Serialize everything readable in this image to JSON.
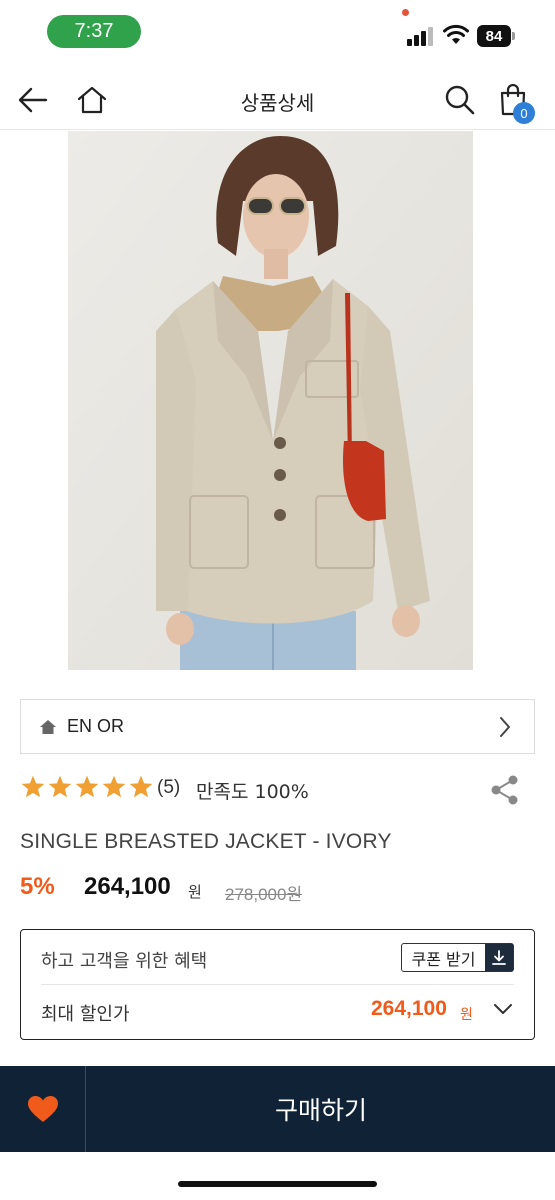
{
  "status_bar": {
    "time": "7:37",
    "battery": "84"
  },
  "header": {
    "title": "상품상세",
    "cart_count": "0",
    "icons": [
      "back-arrow-icon",
      "home-icon",
      "search-icon",
      "shopping-bag-icon"
    ]
  },
  "product": {
    "image_icon": "product-photo",
    "brand": "EN OR",
    "rating": {
      "stars": 5,
      "review_count": "(5)",
      "satisfaction": "만족도 100%"
    },
    "name": "SINGLE BREASTED JACKET - IVORY",
    "price": {
      "discount_rate": "5%",
      "sale_price": "264,100",
      "sale_unit": "원",
      "original_price": "278,000원"
    }
  },
  "benefit": {
    "label": "하고 고객을 위한 혜택",
    "coupon_button": "쿠폰 받기",
    "max_discount_label": "최대 할인가",
    "max_discount_price": "264,100",
    "max_discount_unit": "원"
  },
  "bottom_bar": {
    "buy_label": "구매하기"
  },
  "colors": {
    "accent": "#f05a1a",
    "navy": "#0f2236",
    "star": "#f0a033",
    "badge": "#2f7fd8"
  }
}
